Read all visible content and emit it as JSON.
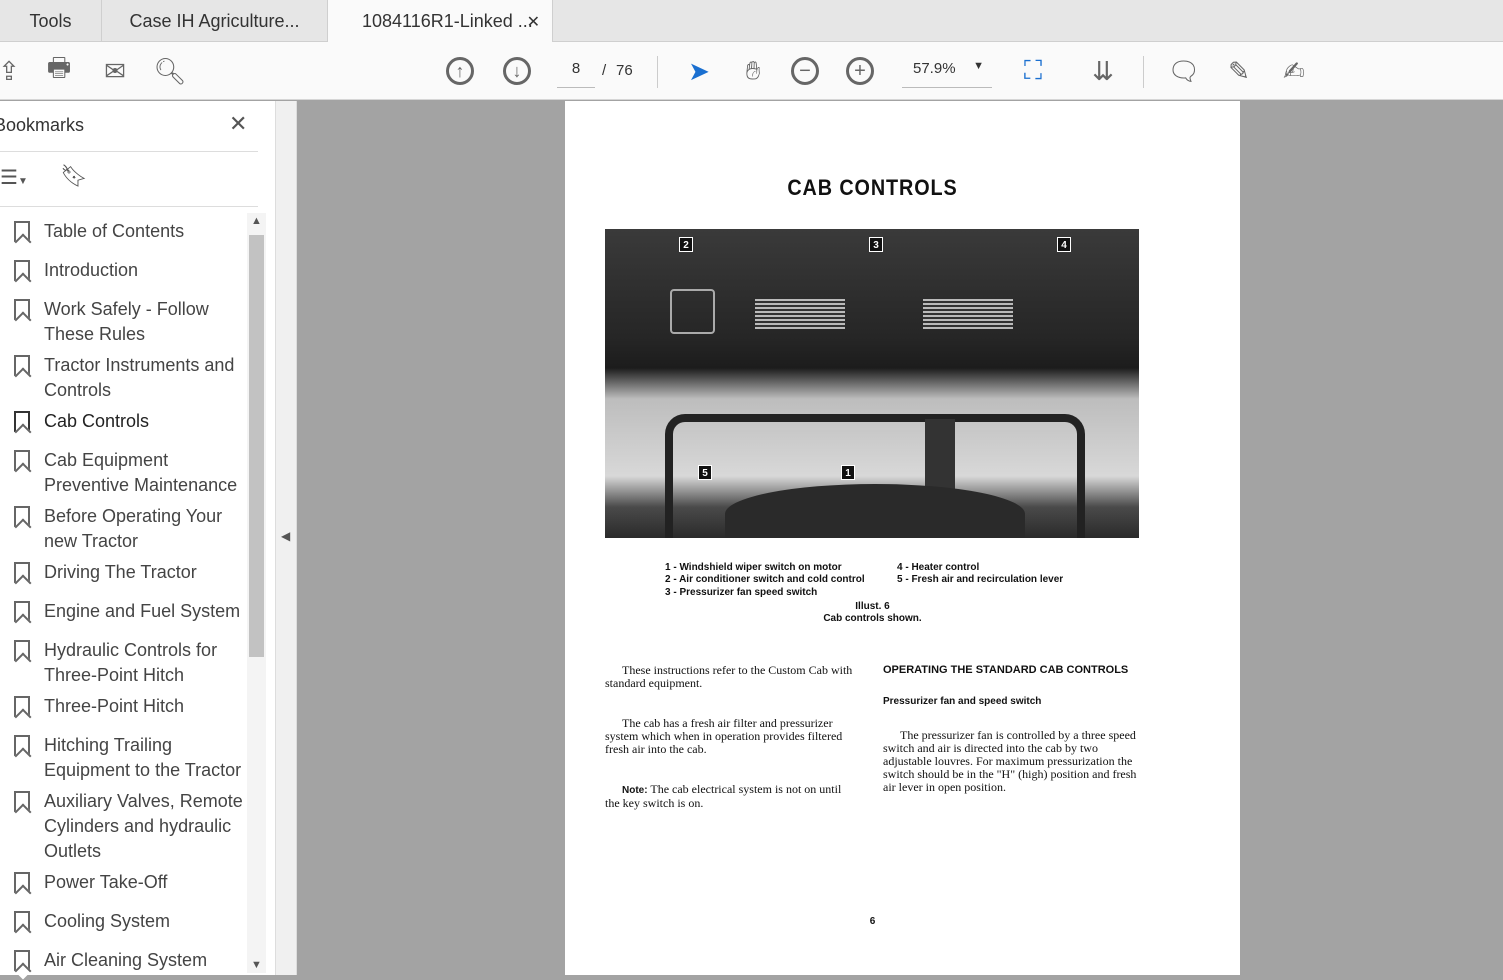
{
  "tabs": [
    "Tools",
    "Case IH Agriculture...",
    "1084116R1-Linked ..."
  ],
  "toolbar": {
    "page_current": "8",
    "page_sep": "/",
    "page_total": "76",
    "zoom": "57.9%"
  },
  "sidebar": {
    "title": "Bookmarks",
    "items": [
      "Table of Contents",
      "Introduction",
      "Work Safely - Follow These Rules",
      "Tractor Instruments and Controls",
      "Cab Controls",
      "Cab Equipment Preventive Maintenance",
      "Before Operating Your new Tractor",
      "Driving The Tractor",
      "Engine and Fuel System",
      "Hydraulic Controls for Three-Point Hitch",
      "Three-Point Hitch",
      "Hitching Trailing Equipment to the Tractor",
      "Auxiliary Valves, Remote Cylinders and hydraulic Outlets",
      "Power Take-Off",
      "Cooling System",
      "Air Cleaning System"
    ]
  },
  "document": {
    "title": "CAB CONTROLS",
    "callouts": [
      "1",
      "2",
      "3",
      "4",
      "5"
    ],
    "legend_left": [
      "1 - Windshield wiper switch on motor",
      "2 - Air conditioner switch and cold control",
      "3 - Pressurizer fan speed switch"
    ],
    "legend_right": [
      "4 - Heater control",
      "5 - Fresh air and recirculation lever"
    ],
    "illust": "Illust. 6",
    "illust_caption": "Cab controls shown.",
    "left_p1": "These instructions refer to the Custom Cab with standard equipment.",
    "left_p2": "The cab has a fresh air filter and pressurizer system which when in operation provides filtered fresh air into the cab.",
    "note_label": "Note:",
    "left_p3": "The cab electrical system is not on until the key switch is on.",
    "right_heading": "OPERATING THE STANDARD CAB CONTROLS",
    "right_sub": "Pressurizer fan and speed switch",
    "right_p": "The pressurizer fan is controlled by a three speed switch and air is directed into the cab by two adjustable louvres. For maximum pressurization the switch should be in the \"H\" (high) position and fresh air lever in open position.",
    "page_number": "6"
  }
}
